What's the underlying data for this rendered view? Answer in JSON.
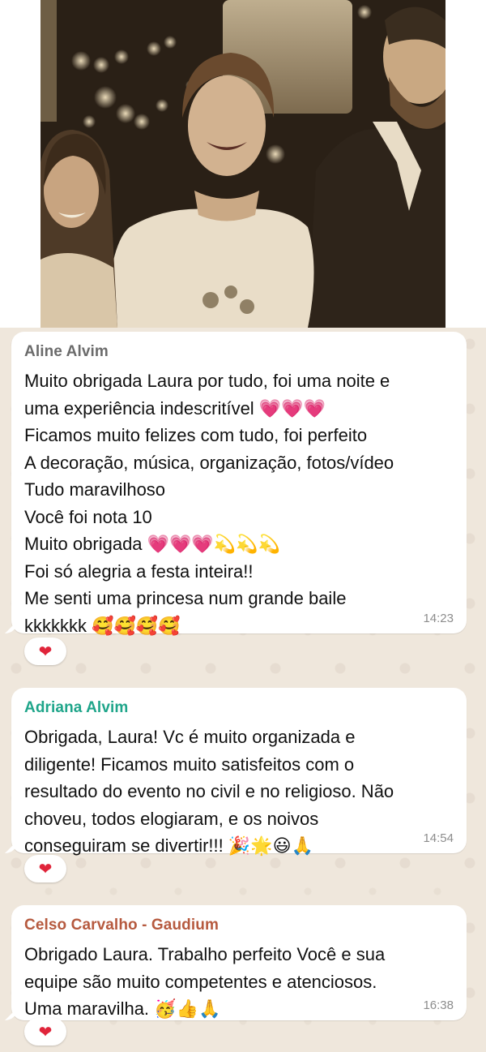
{
  "colors": {
    "chat_background": "#efe7dc",
    "bubble_background": "#ffffff",
    "sender_aline": "#6b6b6b",
    "sender_adriana": "#1fa58a",
    "sender_celso": "#b65a3f",
    "timestamp": "#8c8c8c",
    "heart": "#e0243a"
  },
  "photo": {
    "description_icon": "wedding-photo-sepia"
  },
  "messages": [
    {
      "sender": "Aline Alvim",
      "lines": [
        "Muito obrigada Laura por tudo, foi uma noite e",
        "uma experiência indescritível 💗💗💗",
        "Ficamos muito felizes com tudo, foi perfeito",
        "A decoração, música, organização, fotos/vídeo",
        "Tudo maravilhoso",
        "Você foi nota 10",
        "Muito obrigada 💗💗💗💫💫💫",
        "Foi só alegria a festa inteira!!",
        "Me senti uma princesa num grande baile",
        "kkkkkkk 🥰🥰🥰🥰"
      ],
      "time": "14:23",
      "reaction": "❤"
    },
    {
      "sender": "Adriana Alvim",
      "lines": [
        "Obrigada, Laura! Vc é muito organizada e",
        "diligente! Ficamos muito satisfeitos com o",
        "resultado do evento no civil e no religioso. Não",
        "choveu, todos elogiaram, e os noivos",
        "conseguiram se divertir!!! 🎉🌟😃🙏"
      ],
      "time": "14:54",
      "reaction": "❤"
    },
    {
      "sender": "Celso Carvalho - Gaudium",
      "lines": [
        "Obrigado Laura. Trabalho perfeito   Você e sua",
        "equipe  são muito competentes e atenciosos.",
        "Uma maravilha. 🥳👍🙏"
      ],
      "time": "16:38",
      "reaction": "❤"
    }
  ]
}
